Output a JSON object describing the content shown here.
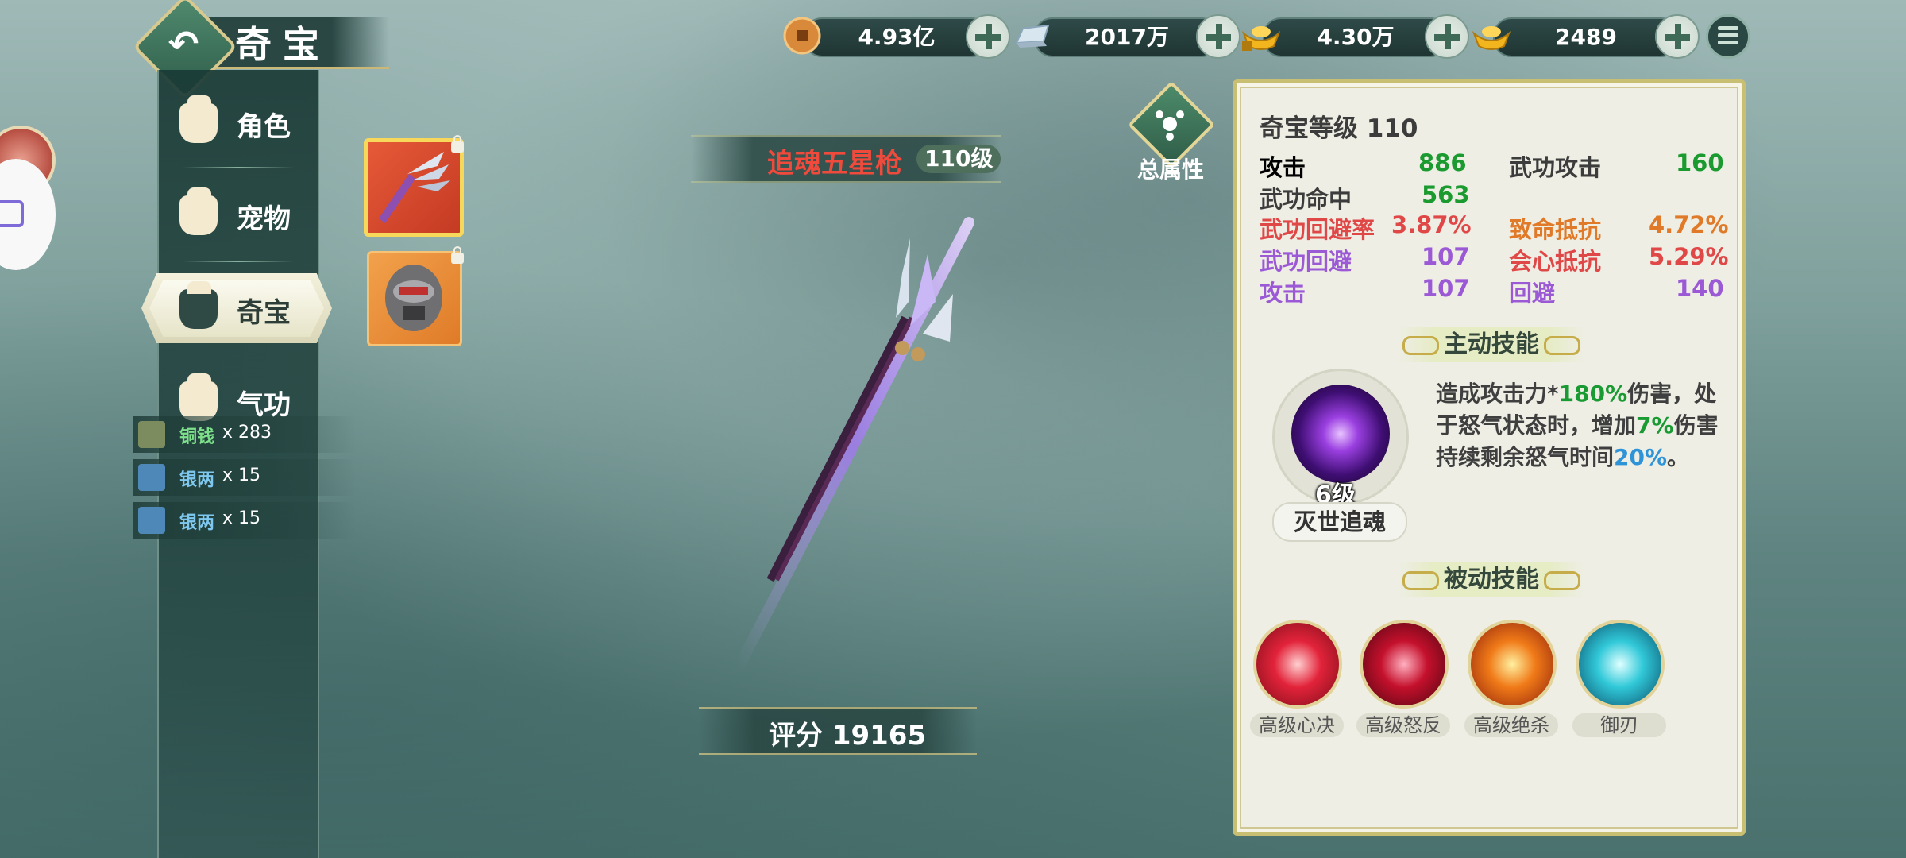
{
  "currency": [
    {
      "name": "copper-coin",
      "value": "4.93亿"
    },
    {
      "name": "silver-ingot",
      "value": "2017万"
    },
    {
      "name": "gold-ingot-locked",
      "value": "4.30万"
    },
    {
      "name": "gold-ingot",
      "value": "2489"
    }
  ],
  "header": {
    "title": "奇宝"
  },
  "nav": [
    {
      "label": "角色",
      "icon": "fist-icon"
    },
    {
      "label": "宠物",
      "icon": "fist-icon"
    },
    {
      "label": "奇宝",
      "icon": "fist-icon",
      "active": true
    },
    {
      "label": "气功",
      "icon": "fist-icon"
    }
  ],
  "loot": [
    {
      "name": "铜钱",
      "qty": "x 283",
      "color": "#7ee08a"
    },
    {
      "name": "银两",
      "qty": "x 15",
      "color": "#7ec8f0"
    },
    {
      "name": "银两",
      "qty": "x 15",
      "color": "#7ec8f0"
    }
  ],
  "weapon": {
    "name": "追魂五星枪",
    "level": "110级",
    "score": "评分 19165"
  },
  "total_attr": {
    "label": "总属性"
  },
  "panel": {
    "title": "奇宝等级 110",
    "stats": [
      {
        "label": "攻击",
        "value": "886",
        "color": "#3c3c3c",
        "vcolor": "#1b9b2f"
      },
      {
        "label": "武功攻击",
        "value": "160",
        "color": "#3c3c3c",
        "vcolor": "#1b9b2f"
      },
      {
        "label": "武功命中",
        "value": "563",
        "color": "#3c3c3c",
        "vcolor": "#1b9b2f"
      },
      {
        "label": "武功回避率",
        "value": "3.87%",
        "color": "#e04848",
        "vcolor": "#e04848"
      },
      {
        "label": "致命抵抗",
        "value": "4.72%",
        "color": "#e07a28",
        "vcolor": "#e07a28"
      },
      {
        "label": "武功回避",
        "value": "107",
        "color": "#9b59d6",
        "vcolor": "#9b59d6"
      },
      {
        "label": "会心抵抗",
        "value": "5.29%",
        "color": "#e04848",
        "vcolor": "#e04848"
      },
      {
        "label": "攻击",
        "value": "107",
        "color": "#9b59d6",
        "vcolor": "#9b59d6"
      },
      {
        "label": "回避",
        "value": "140",
        "color": "#9b59d6",
        "vcolor": "#9b59d6"
      }
    ],
    "active_skill": {
      "header": "主动技能",
      "level": "6级",
      "name": "灭世追魂",
      "desc_1": "造成攻击力*",
      "desc_2": "180%",
      "desc_3": "伤害，处于怒气状态时，增加",
      "desc_4": "7%",
      "desc_5": "伤害持续剩余怒气时间",
      "desc_6": "20%",
      "desc_7": "。"
    },
    "passive_skills": {
      "header": "被动技能",
      "items": [
        {
          "name": "高级心决"
        },
        {
          "name": "高级怒反"
        },
        {
          "name": "高级绝杀"
        },
        {
          "name": "御刃"
        }
      ]
    }
  }
}
